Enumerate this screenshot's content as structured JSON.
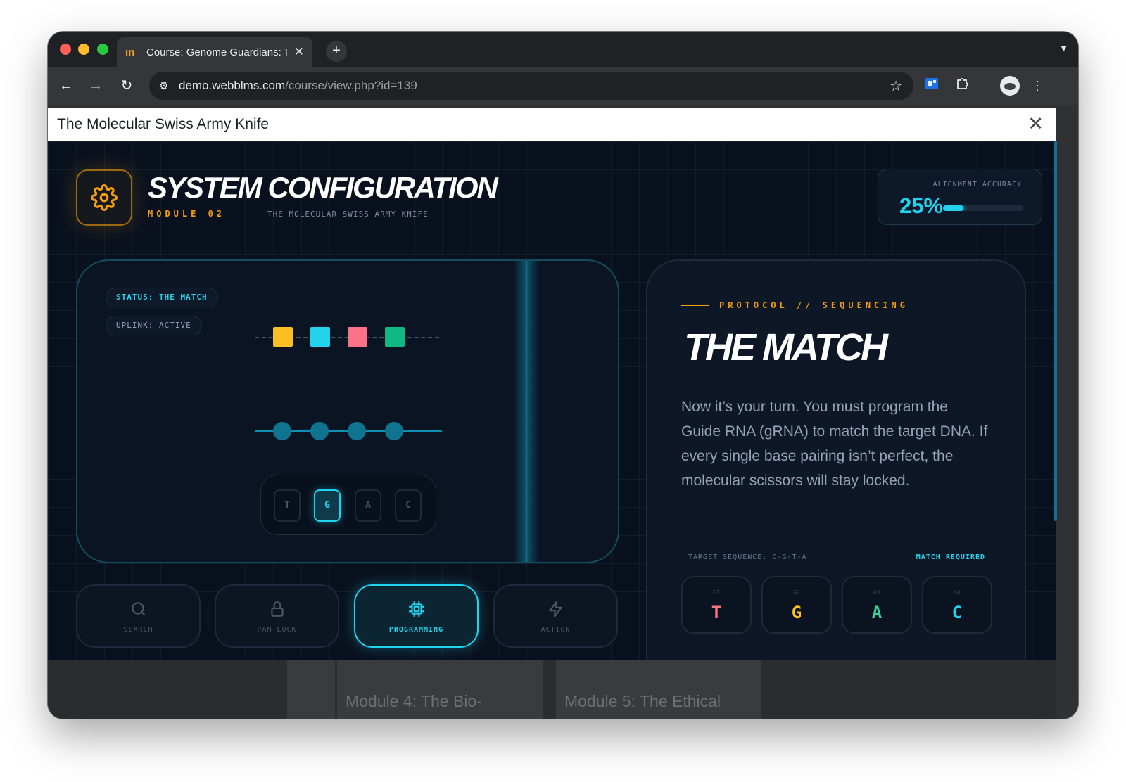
{
  "browser": {
    "tab_title": "Course: Genome Guardians: T",
    "tab_favicon": "ın",
    "url_host": "demo.webblms.com",
    "url_path": "/course/view.php?id=139"
  },
  "modal": {
    "title": "The Molecular Swiss Army Knife"
  },
  "header": {
    "title": "SYSTEM CONFIGURATION",
    "module_label": "MODULE 02",
    "module_subtitle": "THE MOLECULAR SWISS ARMY KNIFE"
  },
  "accuracy": {
    "label": "ALIGNMENT ACCURACY",
    "value_text": "25%",
    "value": 0.25
  },
  "lab": {
    "status_chip": "STATUS: THE MATCH",
    "uplink_chip": "UPLINK: ACTIVE",
    "dna_bases": [
      {
        "color": "#fbbf24"
      },
      {
        "color": "#22d3ee"
      },
      {
        "color": "#fb7185"
      },
      {
        "color": "#10b981"
      }
    ],
    "keys": [
      {
        "label": "T",
        "active": false
      },
      {
        "label": "G",
        "active": true
      },
      {
        "label": "A",
        "active": false
      },
      {
        "label": "C",
        "active": false
      }
    ]
  },
  "nav": [
    {
      "label": "SEARCH",
      "icon": "search-icon",
      "active": false
    },
    {
      "label": "PAM LOCK",
      "icon": "lock-icon",
      "active": false
    },
    {
      "label": "PROGRAMMING",
      "icon": "chip-icon",
      "active": true
    },
    {
      "label": "ACTION",
      "icon": "lightning-icon",
      "active": false
    }
  ],
  "protocol": {
    "label": "PROTOCOL // SEQUENCING",
    "title": "THE MATCH",
    "body": "Now it’s your turn. You must program the Guide RNA (gRNA) to match the target DNA. If every single base pairing isn’t perfect, the molecular scissors will stay locked.",
    "target_label": "TARGET SEQUENCE: C-G-T-A",
    "match_required": "MATCH REQUIRED",
    "slots": [
      {
        "id": "G1",
        "base": "T",
        "color": "#fb7185"
      },
      {
        "id": "G2",
        "base": "G",
        "color": "#fbbf24"
      },
      {
        "id": "G3",
        "base": "A",
        "color": "#34d399"
      },
      {
        "id": "G4",
        "base": "C",
        "color": "#22d3ee"
      }
    ]
  },
  "background_cards": [
    {
      "title": "Module 4: The Bio-"
    },
    {
      "title": "Module 5: The Ethical"
    }
  ]
}
